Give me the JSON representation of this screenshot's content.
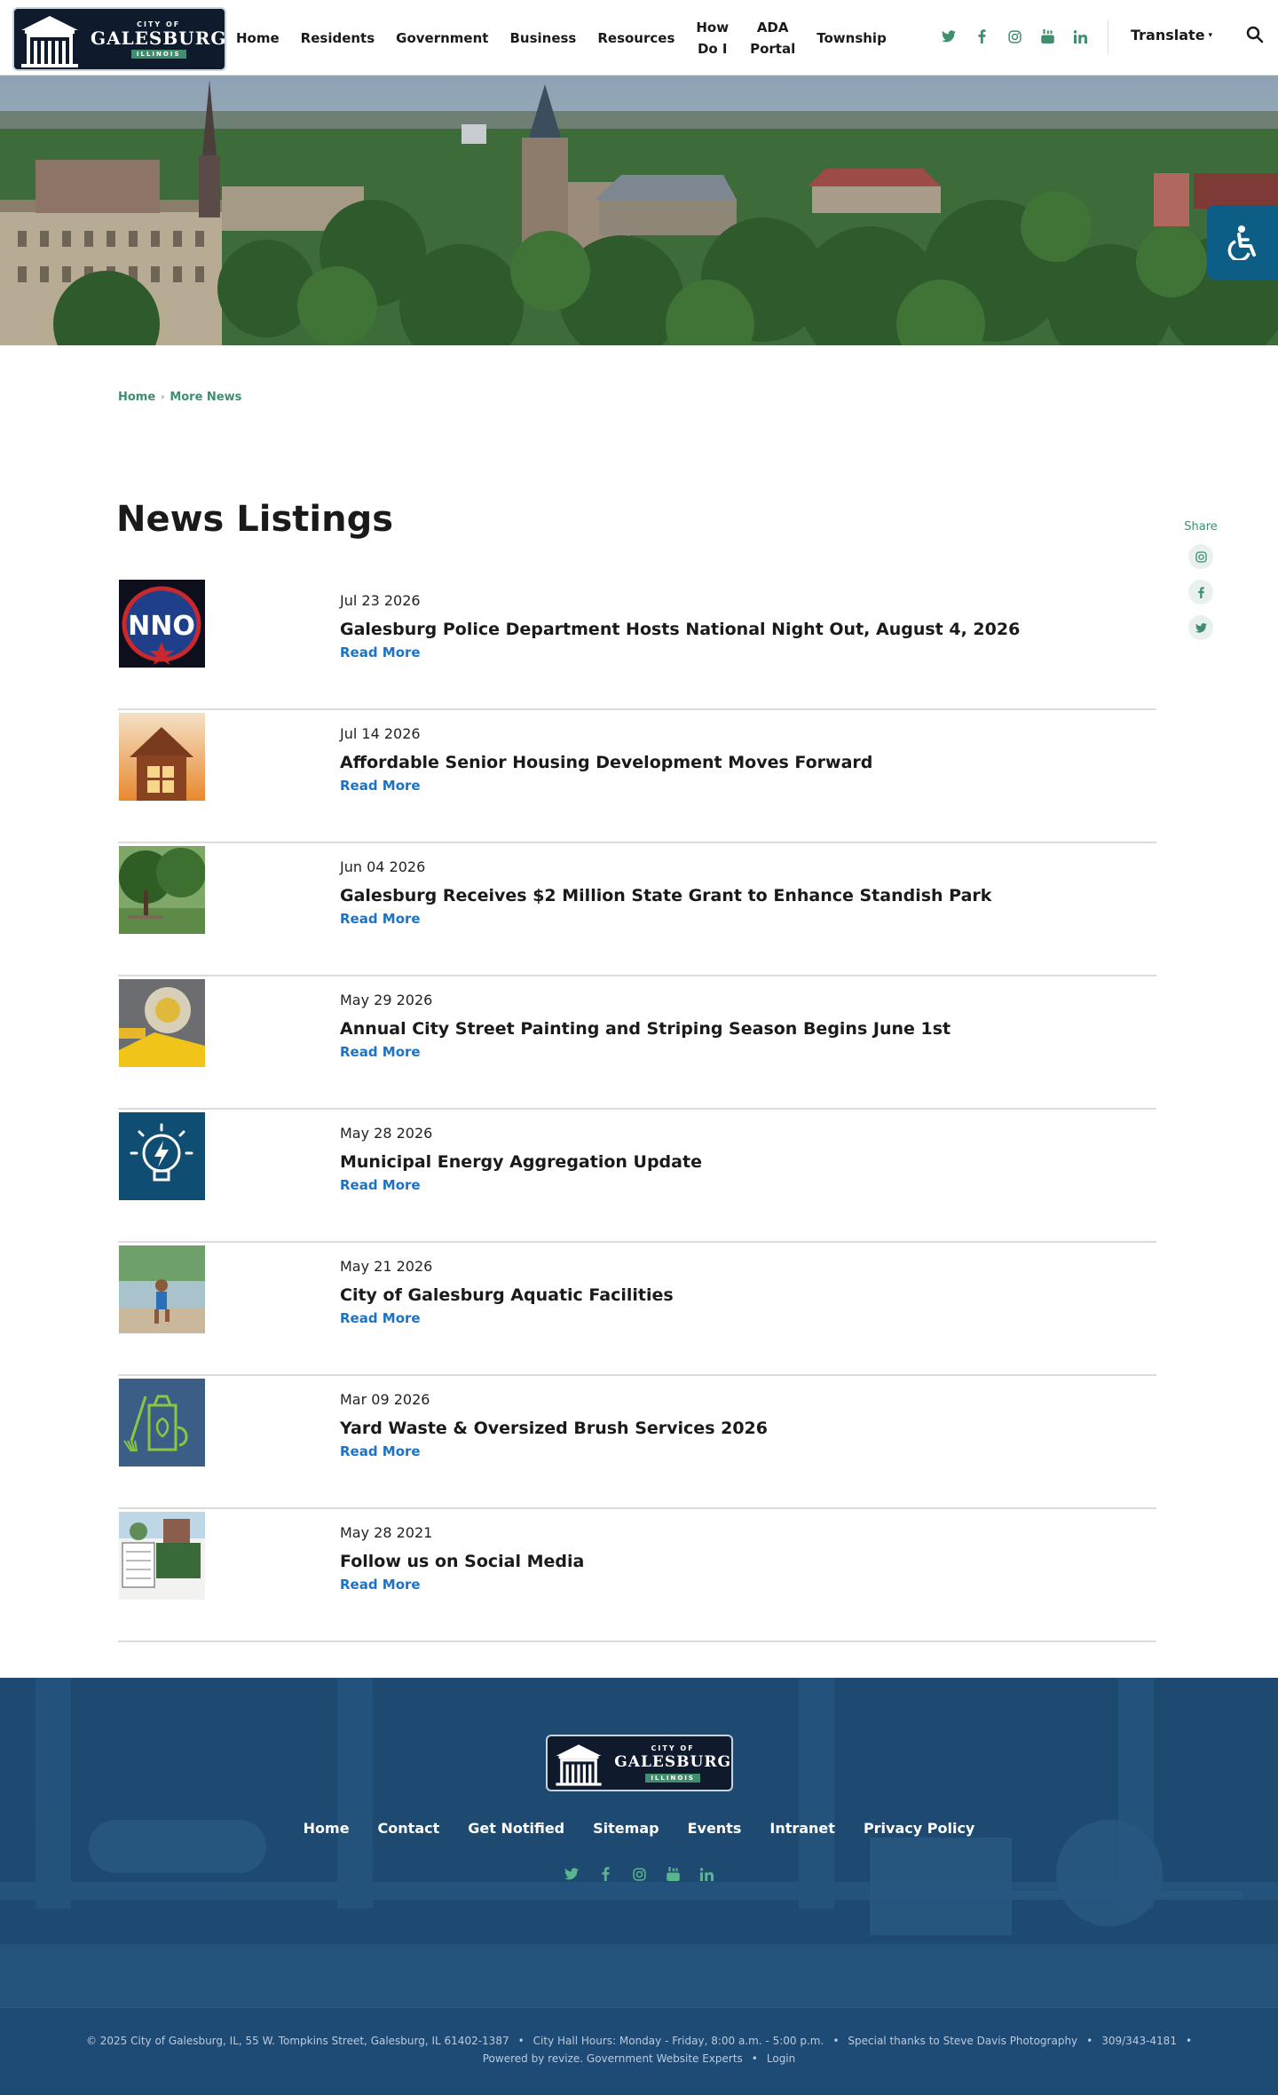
{
  "header": {
    "logo": {
      "small": "CITY OF",
      "big": "GALESBURG",
      "state": "ILLINOIS"
    },
    "nav": [
      {
        "label": "Home"
      },
      {
        "label": "Residents"
      },
      {
        "label": "Government"
      },
      {
        "label": "Business"
      },
      {
        "label": "Resources"
      },
      {
        "label": "How\nDo I"
      },
      {
        "label": "ADA\nPortal"
      },
      {
        "label": "Township"
      }
    ],
    "social_icons": [
      "twitter-icon",
      "facebook-icon",
      "instagram-icon",
      "youtube-icon",
      "linkedin-icon"
    ],
    "translate_label": "Translate"
  },
  "breadcrumb": {
    "home": "Home",
    "current": "More News"
  },
  "page_title": "News Listings",
  "share": {
    "label": "Share"
  },
  "news": [
    {
      "date": "Jul 23 2026",
      "title": "Galesburg Police Department Hosts National Night Out, August 4, 2026",
      "more": "Read More",
      "thumb": "nno"
    },
    {
      "date": "Jul 14 2026",
      "title": "Affordable Senior Housing Development Moves Forward",
      "more": "Read More",
      "thumb": "house"
    },
    {
      "date": "Jun 04 2026",
      "title": "Galesburg Receives $2 Million State Grant to Enhance Standish Park",
      "more": "Read More",
      "thumb": "park"
    },
    {
      "date": "May 29 2026",
      "title": "Annual City Street Painting and Striping Season Begins June 1st",
      "more": "Read More",
      "thumb": "paint"
    },
    {
      "date": "May 28 2026",
      "title": "Municipal Energy Aggregation Update",
      "more": "Read More",
      "thumb": "energy"
    },
    {
      "date": "May 21 2026",
      "title": "City of Galesburg Aquatic Facilities",
      "more": "Read More",
      "thumb": "aquatic"
    },
    {
      "date": "Mar 09 2026",
      "title": "Yard Waste & Oversized Brush Services 2026",
      "more": "Read More",
      "thumb": "yard"
    },
    {
      "date": "May 28 2021",
      "title": "Follow us on Social Media",
      "more": "Read More",
      "thumb": "social"
    }
  ],
  "footer": {
    "links": [
      {
        "label": "Home"
      },
      {
        "label": "Contact"
      },
      {
        "label": "Get Notified"
      },
      {
        "label": "Sitemap"
      },
      {
        "label": "Events"
      },
      {
        "label": "Intranet"
      },
      {
        "label": "Privacy Policy"
      }
    ],
    "copyright": "© 2025 City of Galesburg, IL, 55 W. Tompkins Street, Galesburg, IL 61402-1387",
    "hours": "City Hall Hours: Monday - Friday, 8:00 a.m. - 5:00 p.m.",
    "thanks": "Special thanks to Steve Davis Photography",
    "phone": "309/343-4181",
    "powered": "Powered by revize. Government Website Experts",
    "login": "Login"
  },
  "colors": {
    "accent_green": "#3f8f6f",
    "link_blue": "#1b73c7",
    "footer_blue": "#1e4a72",
    "access_blue": "#0d5e86"
  }
}
